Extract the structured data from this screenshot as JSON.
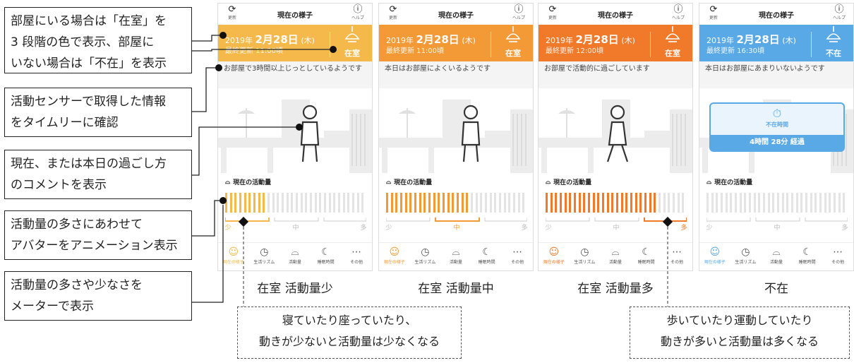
{
  "callouts": [
    {
      "text": "部屋にいる場合は「在室」を\n3 段階の色で表示、部屋に\nいない場合は「不在」を表示"
    },
    {
      "text": "活動センサーで取得した情報\nをタイムリーに確認"
    },
    {
      "text": "現在、または本日の過ごし方\nのコメントを表示"
    },
    {
      "text": "活動量の多さにあわせて\nアバターをアニメーション表示"
    },
    {
      "text": "活動量の多さや少なさを\nメーターで表示"
    }
  ],
  "app": {
    "refresh_label": "更新",
    "title": "現在の様子",
    "help_label": "ヘルプ",
    "meter_title": "現在の活動量",
    "scale": [
      "少",
      "中",
      "多"
    ],
    "tabs": [
      "現在の様子",
      "生活リズム",
      "活動量",
      "睡眠時間",
      "その他"
    ],
    "absence_box_title": "不在時間",
    "absence_box_value": "4時間 28分 経過"
  },
  "screens": [
    {
      "accent": "#f5b84a",
      "date_prefix": "2019年",
      "date_main": "2月28日",
      "date_suffix": "(木)",
      "updated": "最終更新 11:00頃",
      "status": "在室",
      "comment": "お部屋で3時間以上じっとしているようです",
      "level": 0.3,
      "caption": "在室  活動量少",
      "scale_active": 0
    },
    {
      "accent": "#f39a36",
      "date_prefix": "2019年",
      "date_main": "2月28日",
      "date_suffix": "(木)",
      "updated": "最終更新 11:00頃",
      "status": "在室",
      "comment": "本日はお部屋によくいるようです",
      "level": 0.6,
      "caption": "在室  活動量中",
      "scale_active": 1
    },
    {
      "accent": "#f07a2a",
      "date_prefix": "2019年",
      "date_main": "2月28日",
      "date_suffix": "(木)",
      "updated": "最終更新 12:00頃",
      "status": "在室",
      "comment": "お部屋で活動的に過ごしています",
      "level": 0.78,
      "caption": "在室  活動量多",
      "scale_active": 2
    },
    {
      "accent": "#59a9e6",
      "date_prefix": "2019年",
      "date_main": "2月28日",
      "date_suffix": "(木)",
      "updated": "最終更新 16:30頃",
      "status": "不在",
      "comment": "本日はお部屋にあまりいないようです",
      "level": 0,
      "caption": "不在",
      "scale_active": -1
    }
  ],
  "notes": [
    {
      "text": "寝ていたり座っていたり、\n動きが少ないと活動量は少なくなる"
    },
    {
      "text": "歩いていたり運動していたり\n動きが多いと活動量は多くなる"
    }
  ]
}
